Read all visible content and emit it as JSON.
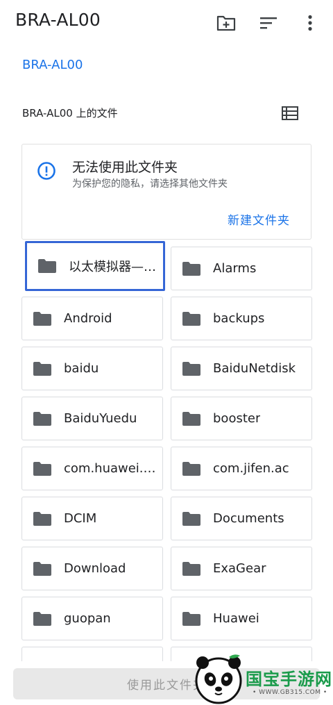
{
  "header": {
    "title": "BRA-AL00",
    "icons": [
      "new-folder-icon",
      "sort-icon",
      "more-vert-icon"
    ]
  },
  "breadcrumb": "BRA-AL00",
  "section_label": "BRA-AL00 上的文件",
  "notice": {
    "title": "无法使用此文件夹",
    "subtitle": "为保护您的隐私，请选择其他文件夹",
    "action": "新建文件夹"
  },
  "folders": [
    "以太模拟器—…",
    "Alarms",
    "Android",
    "backups",
    "baidu",
    "BaiduNetdisk",
    "BaiduYuedu",
    "booster",
    "com.huawei.…",
    "com.jifen.ac",
    "DCIM",
    "Documents",
    "Download",
    "ExaGear",
    "guopan",
    "Huawei"
  ],
  "bottom_button": "使用此文件夹",
  "watermark": {
    "brand": "国宝手游网",
    "url": "• WWW.GB315.COM •"
  },
  "colors": {
    "accent": "#1a73e8",
    "highlight_border": "#3566d6",
    "folder_icon": "#5f6368"
  }
}
